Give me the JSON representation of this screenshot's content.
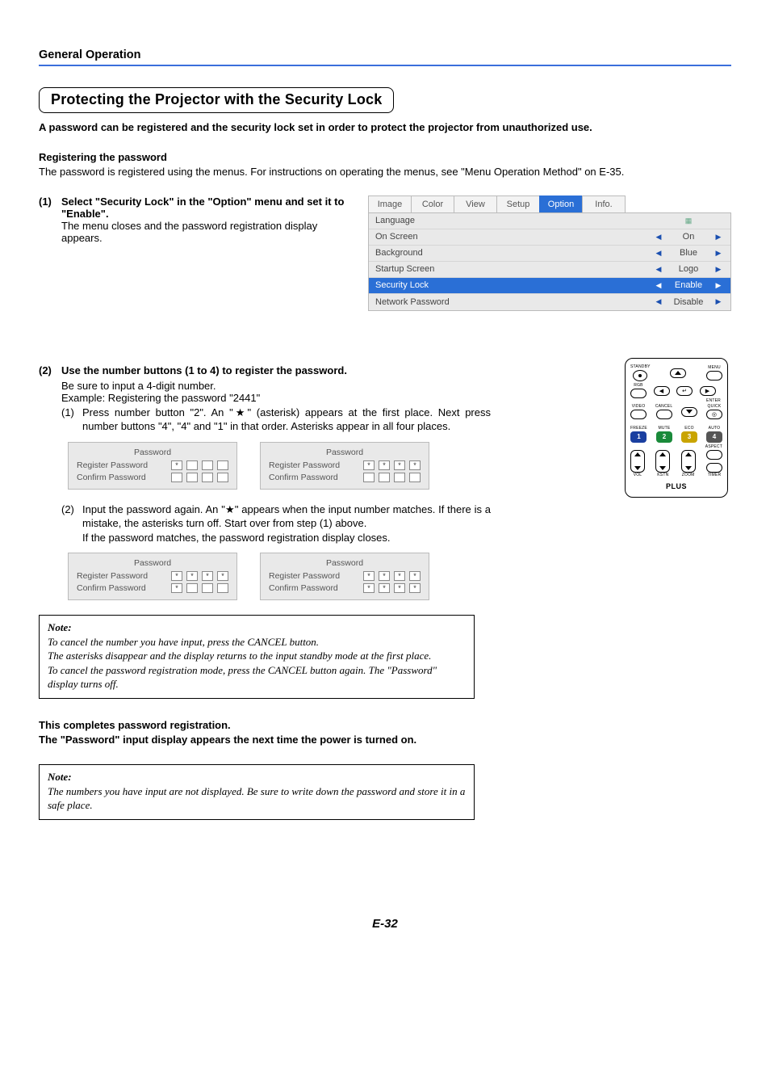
{
  "header": "General Operation",
  "title": "Protecting the Projector with the Security Lock",
  "intro": "A password can be registered and the security lock set in order to protect the projector from unauthorized use.",
  "reg_heading": "Registering the password",
  "reg_text": "The password is registered using the menus. For instructions on operating the menus, see \"Menu Operation Method\" on E-35.",
  "step1_num": "(1)",
  "step1_bold": "Select \"Security Lock\" in the \"Option\" menu and set it to \"Enable\".",
  "step1_plain": "The menu closes and the password registration display appears.",
  "menu": {
    "tabs": [
      "Image",
      "Color",
      "View",
      "Setup",
      "Option",
      "Info."
    ],
    "active_index": 4,
    "rows": [
      {
        "label": "Language",
        "left": "",
        "value_icon": "▦",
        "right": ""
      },
      {
        "label": "On Screen",
        "left": "◀",
        "value": "On",
        "right": "▶"
      },
      {
        "label": "Background",
        "left": "◀",
        "value": "Blue",
        "right": "▶"
      },
      {
        "label": "Startup Screen",
        "left": "◀",
        "value": "Logo",
        "right": "▶"
      },
      {
        "label": "Security Lock",
        "left": "◀",
        "value": "Enable",
        "right": "▶",
        "selected": true
      },
      {
        "label": "Network Password",
        "left": "◀",
        "value": "Disable",
        "right": "▶"
      }
    ]
  },
  "step2_num": "(2)",
  "step2_bold": "Use the number buttons (1 to 4) to register the password.",
  "step2_line1": "Be sure to input a 4-digit number.",
  "step2_line2": "Example: Registering the password \"2441\"",
  "sub1_num": "(1)",
  "sub1_text": "Press number button \"2\". An \"★\" (asterisk) appears at the first place. Next press number buttons \"4\", \"4\" and \"1\" in that order. Asterisks appear in all four places.",
  "sub2_num": "(2)",
  "sub2_text": "Input the password again. An \"★\" appears when the input number matches. If there is a mistake, the asterisks turn off. Start over from step (1) above.",
  "sub2_tail": "If the password matches, the password registration display closes.",
  "pw": {
    "title": "Password",
    "register": "Register Password",
    "confirm": "Confirm Password",
    "asterisk": "*"
  },
  "panel_states": {
    "a": {
      "reg": [
        true,
        false,
        false,
        false
      ],
      "conf": [
        false,
        false,
        false,
        false
      ]
    },
    "b": {
      "reg": [
        true,
        true,
        true,
        true
      ],
      "conf": [
        false,
        false,
        false,
        false
      ]
    },
    "c": {
      "reg": [
        true,
        true,
        true,
        true
      ],
      "conf": [
        true,
        false,
        false,
        false
      ]
    },
    "d": {
      "reg": [
        true,
        true,
        true,
        true
      ],
      "conf": [
        true,
        true,
        true,
        true
      ]
    }
  },
  "note1_head": "Note:",
  "note1_l1": "To cancel the number you have input, press the CANCEL button.",
  "note1_l2": "The asterisks disappear and the display returns to the input standby mode at the first place.",
  "note1_l3": "To cancel the password registration mode, press the CANCEL button again. The \"Password\" display turns off.",
  "completion1": "This completes password registration.",
  "completion2": "The \"Password\" input display appears the next time the power is turned on.",
  "note2_head": "Note:",
  "note2_text": "The numbers you have input are not displayed. Be sure to write down the password and store it in a safe place.",
  "remote": {
    "labels": {
      "standby": "STANDBY",
      "menu": "MENU",
      "rgb": "RGB",
      "enter": "ENTER",
      "video": "VIDEO",
      "cancel": "CANCEL",
      "quick": "QUICK",
      "freeze": "FREEZE",
      "mute": "MUTE",
      "eco": "ECO",
      "auto": "AUTO",
      "n1": "1",
      "n2": "2",
      "n3": "3",
      "n4": "4",
      "vol": "VOL",
      "kstn": "KSTN",
      "zoom": "ZOOM",
      "aspect": "ASPECT",
      "timer": "TIMER"
    },
    "brand": "PLUS"
  },
  "page_number": "E-32"
}
